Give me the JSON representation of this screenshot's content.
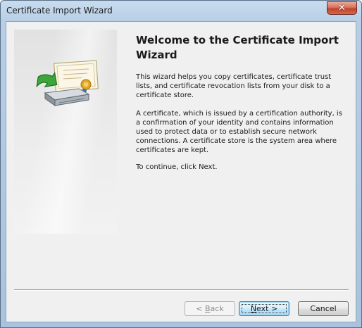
{
  "window": {
    "title": "Certificate Import Wizard"
  },
  "header": {
    "close_icon": "close-icon"
  },
  "main": {
    "title": "Welcome to the Certificate Import Wizard",
    "paragraph_1": "This wizard helps you copy certificates, certificate trust lists, and certificate revocation lists from your disk to a certificate store.",
    "paragraph_2": "A certificate, which is issued by a certification authority, is a confirmation of your identity and contains information used to protect data or to establish secure network connections. A certificate store is the system area where certificates are kept.",
    "paragraph_3": "To continue, click Next.",
    "graphic_icon": "certificate-import-icon"
  },
  "buttons": {
    "back": {
      "pre": "< ",
      "accel": "B",
      "post": "ack"
    },
    "next": {
      "accel": "N",
      "post": "ext >"
    },
    "cancel_label": "Cancel"
  },
  "colors": {
    "accent": "#3c7fb1",
    "close": "#c0442c"
  }
}
